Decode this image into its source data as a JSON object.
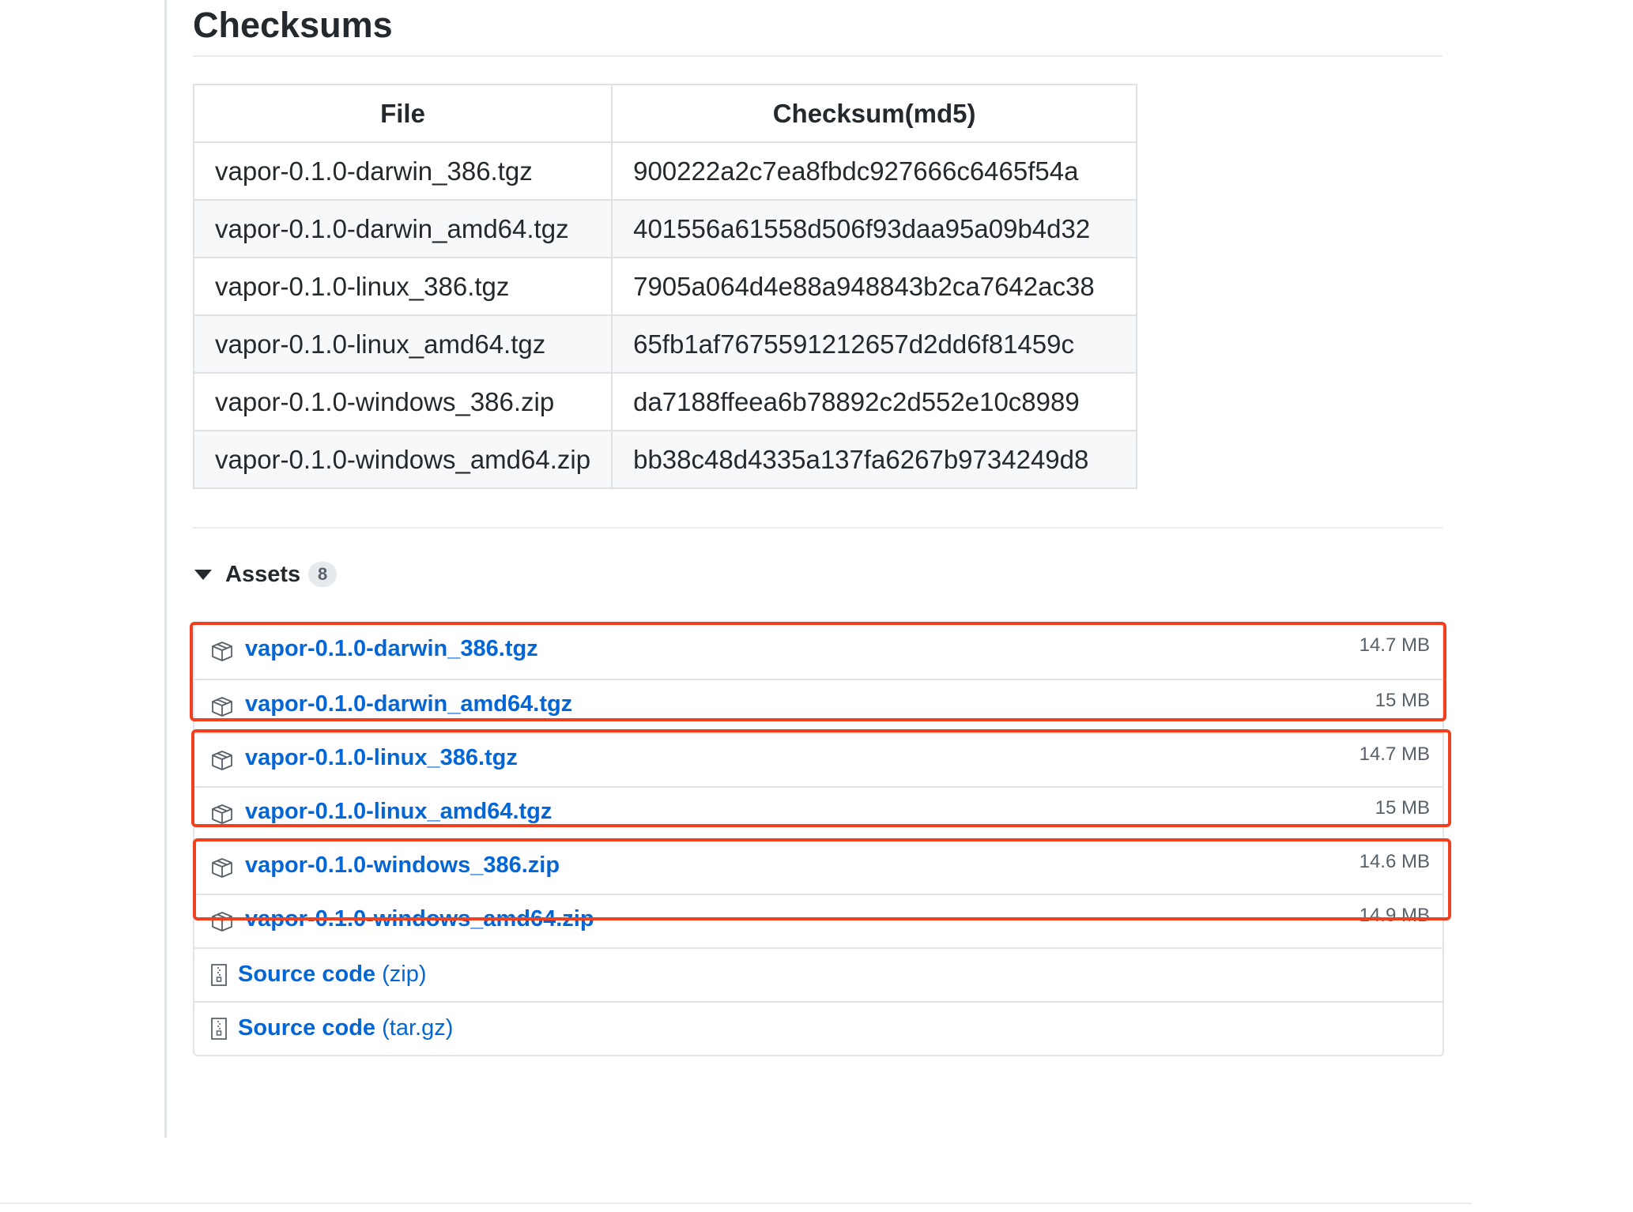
{
  "section_title": "Checksums",
  "checksum_table": {
    "headers": [
      "File",
      "Checksum(md5)"
    ],
    "rows": [
      [
        "vapor-0.1.0-darwin_386.tgz",
        "900222a2c7ea8fbdc927666c6465f54a"
      ],
      [
        "vapor-0.1.0-darwin_amd64.tgz",
        "401556a61558d506f93daa95a09b4d32"
      ],
      [
        "vapor-0.1.0-linux_386.tgz",
        "7905a064d4e88a948843b2ca7642ac38"
      ],
      [
        "vapor-0.1.0-linux_amd64.tgz",
        "65fb1af7675591212657d2dd6f81459c"
      ],
      [
        "vapor-0.1.0-windows_386.zip",
        "da7188ffeea6b78892c2d552e10c8989"
      ],
      [
        "vapor-0.1.0-windows_amd64.zip",
        "bb38c48d4335a137fa6267b9734249d8"
      ]
    ]
  },
  "assets": {
    "label": "Assets",
    "count": "8",
    "files": [
      {
        "name": "vapor-0.1.0-darwin_386.tgz",
        "size": "14.7 MB"
      },
      {
        "name": "vapor-0.1.0-darwin_amd64.tgz",
        "size": "15 MB"
      },
      {
        "name": "vapor-0.1.0-linux_386.tgz",
        "size": "14.7 MB"
      },
      {
        "name": "vapor-0.1.0-linux_amd64.tgz",
        "size": "15 MB"
      },
      {
        "name": "vapor-0.1.0-windows_386.zip",
        "size": "14.6 MB"
      },
      {
        "name": "vapor-0.1.0-windows_amd64.zip",
        "size": "14.9 MB"
      }
    ],
    "source": [
      {
        "label": "Source code",
        "format": "(zip)"
      },
      {
        "label": "Source code",
        "format": "(tar.gz)"
      }
    ]
  },
  "colors": {
    "link": "#0366d6",
    "highlight": "#f0401f",
    "text": "#24292e",
    "muted": "#586069"
  },
  "icons": {
    "asset": "package-icon",
    "source": "file-zip-icon",
    "toggle": "triangle-down-icon"
  }
}
